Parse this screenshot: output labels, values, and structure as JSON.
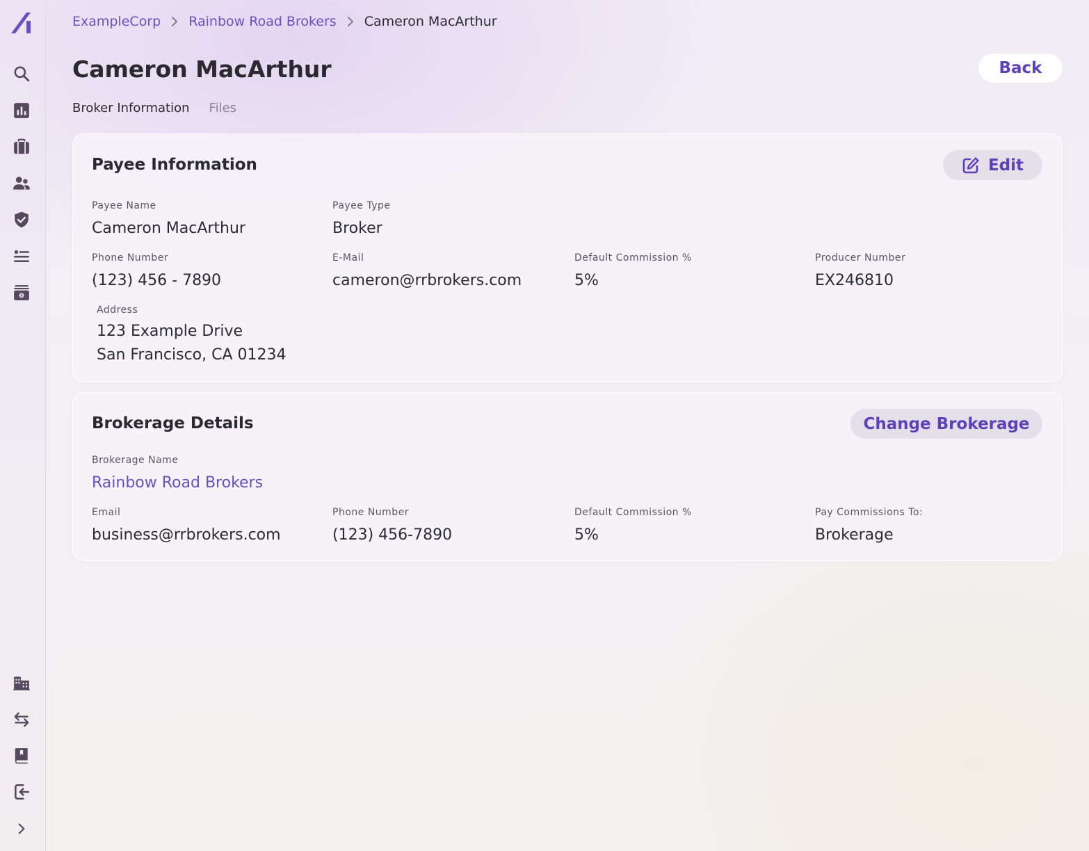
{
  "sidebar": {
    "top_icons": [
      "logo-icon",
      "search-icon",
      "chart-icon",
      "briefcase-icon",
      "users-icon",
      "shield-icon",
      "list-icon",
      "payments-icon"
    ],
    "bottom_icons": [
      "buildings-icon",
      "transfer-icon",
      "book-icon",
      "logout-icon",
      "expand-icon"
    ]
  },
  "breadcrumb": {
    "items": [
      "ExampleCorp",
      "Rainbow Road Brokers"
    ],
    "current": "Cameron MacArthur"
  },
  "page": {
    "title": "Cameron MacArthur",
    "back_label": "Back"
  },
  "tabs": [
    {
      "label": "Broker Information",
      "active": true
    },
    {
      "label": "Files",
      "active": false
    }
  ],
  "payee": {
    "title": "Payee Information",
    "edit_label": "Edit",
    "fields": {
      "payee_name": {
        "label": "Payee Name",
        "value": "Cameron MacArthur"
      },
      "payee_type": {
        "label": "Payee Type",
        "value": "Broker"
      },
      "phone": {
        "label": "Phone Number",
        "value": "(123) 456 - 7890"
      },
      "email": {
        "label": "E-Mail",
        "value": "cameron@rrbrokers.com"
      },
      "commission": {
        "label": "Default Commission %",
        "value": "5%"
      },
      "producer": {
        "label": "Producer Number",
        "value": "EX246810"
      },
      "address": {
        "label": "Address",
        "line1": "123 Example Drive",
        "line2": "San Francisco, CA 01234"
      }
    }
  },
  "brokerage": {
    "title": "Brokerage Details",
    "change_label": "Change Brokerage",
    "fields": {
      "name": {
        "label": "Brokerage Name",
        "value": "Rainbow Road Brokers"
      },
      "email": {
        "label": "Email",
        "value": "business@rrbrokers.com"
      },
      "phone": {
        "label": "Phone Number",
        "value": "(123) 456-7890"
      },
      "commission": {
        "label": "Default Commission %",
        "value": "5%"
      },
      "pay_to": {
        "label": "Pay Commissions To:",
        "value": "Brokerage"
      }
    }
  },
  "colors": {
    "accent": "#5e40b8",
    "link": "#6a4fbf",
    "icon": "#54495e"
  }
}
